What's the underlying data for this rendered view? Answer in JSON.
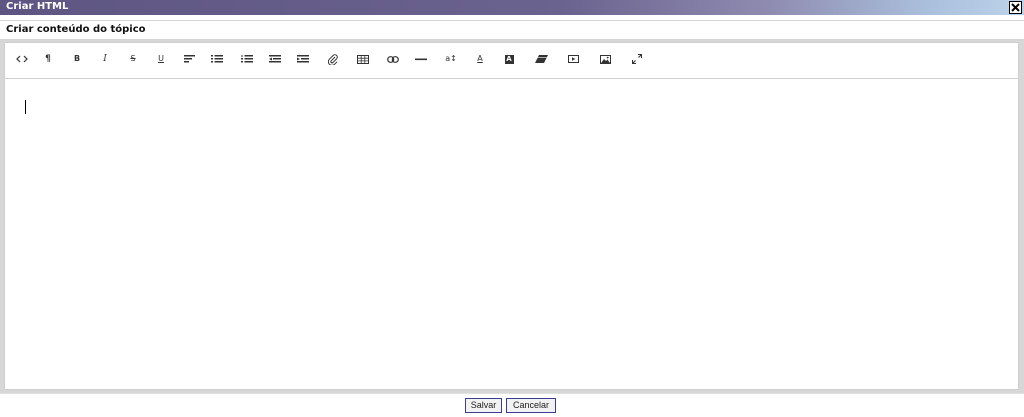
{
  "window": {
    "title": "Criar HTML"
  },
  "section": {
    "title": "Criar conteúdo do tópico"
  },
  "toolbar": {
    "buttons": [
      {
        "icon": "code-view-icon"
      },
      {
        "icon": "paragraph-icon",
        "glyph": "¶"
      },
      {
        "icon": "bold-icon",
        "glyph": "B"
      },
      {
        "icon": "italic-icon",
        "glyph": "I"
      },
      {
        "icon": "strikethrough-icon",
        "glyph": "S"
      },
      {
        "icon": "underline-icon",
        "glyph": "U"
      },
      {
        "icon": "align-icon"
      },
      {
        "icon": "bulleted-list-icon"
      },
      {
        "icon": "numbered-list-icon"
      },
      {
        "icon": "outdent-icon"
      },
      {
        "icon": "indent-icon"
      },
      {
        "icon": "attachment-icon"
      },
      {
        "icon": "table-icon"
      },
      {
        "icon": "link-icon"
      },
      {
        "icon": "horizontal-rule-icon"
      },
      {
        "icon": "font-size-icon",
        "glyph": "a↕"
      },
      {
        "icon": "font-color-icon",
        "glyph": "A"
      },
      {
        "icon": "highlight-color-icon",
        "glyph": "A"
      },
      {
        "icon": "eraser-icon"
      },
      {
        "icon": "video-icon"
      },
      {
        "icon": "image-icon"
      },
      {
        "icon": "fullscreen-icon"
      }
    ]
  },
  "editor": {
    "content": ""
  },
  "footer": {
    "save_label": "Salvar",
    "cancel_label": "Cancelar"
  }
}
